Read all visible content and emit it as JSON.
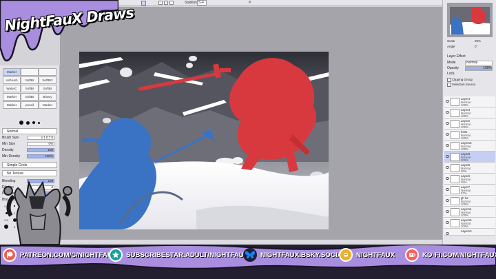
{
  "overlay": {
    "logo_text": "NightFauX Draws",
    "footer_links": [
      {
        "icon": "patreon-icon",
        "text": "PATREON.COM/C/NIGHTFAUX",
        "color": "#f15d4e"
      },
      {
        "icon": "subscribestar-icon",
        "text": "SUBSCRIBESTAR.ADULT/NIGHTFAUX",
        "color": "#1aa0a0"
      },
      {
        "icon": "bluesky-icon",
        "text": "NIGHTFAUX.BSKY.SOCIAL",
        "color": "#1185fe"
      },
      {
        "icon": "sun-mascot-icon",
        "text": "NIGHTFAUX",
        "color": "#f0b020"
      },
      {
        "icon": "kofi-icon",
        "text": "KO-FI.COM/NIGHTFAUX",
        "color": "#ff5e5b"
      }
    ]
  },
  "toolbar": {
    "stabilizer_label": "Stabilizer",
    "stabilizer_value": "S-4"
  },
  "tools": {
    "rows": [
      [
        "Marker",
        "",
        ""
      ],
      [
        "Airbrush",
        "SoftBr",
        "SoftBr2"
      ],
      [
        "WaterC",
        "SoftBr",
        "SoftBr"
      ],
      [
        "Marker",
        "SoftBr",
        "Binary"
      ],
      [
        "Marker",
        "pencil",
        "Marker"
      ]
    ]
  },
  "brush": {
    "mode": "Normal",
    "size_label": "Brush Size",
    "size_multiplier": "x 1.0",
    "size_value": "7.0",
    "min_size_label": "Min Size",
    "min_size_value": "0%",
    "density_label": "Density",
    "density_value": "100",
    "min_density_label": "Min Density",
    "min_density_value": "100%",
    "shape": "Simple Circle",
    "texture": "No Texture",
    "blending_label": "Blending",
    "blending_value": "100",
    "dilution_label": "Dilution",
    "dilution_value": "0",
    "persistence_label": "Persistence",
    "persistence_value": "80",
    "blur_label": "Blur Pressure",
    "size_presets": [
      "0.7",
      "0.8",
      "1",
      "1.5",
      "2",
      "2.3",
      "2.6",
      "3",
      "3.5",
      "4",
      "5",
      "6"
    ]
  },
  "navigator": {
    "scale_label": "Scale",
    "scale_value": "25%",
    "angle_label": "Angle",
    "angle_value": "0°"
  },
  "layer_panel": {
    "layer_effect": "Layer Effect",
    "mode_label": "Mode",
    "mode_value": "Normal",
    "opacity_label": "Opacity",
    "opacity_value": "100%",
    "lock_label": "Lock",
    "clipping_group": "Clipping Group",
    "selection_source": "Selection Source",
    "layers": [
      {
        "name": "Layer4",
        "mode": "Normal",
        "opacity": "100%",
        "selected": false
      },
      {
        "name": "Layer3",
        "mode": "Normal",
        "opacity": "100%",
        "selected": false
      },
      {
        "name": "Layer2",
        "mode": "Normal",
        "opacity": "100%",
        "selected": false
      },
      {
        "name": "fonts",
        "mode": "Normal",
        "opacity": "100%",
        "selected": false
      },
      {
        "name": "Layer16",
        "mode": "Normal",
        "opacity": "100%",
        "selected": false
      },
      {
        "name": "Layer9",
        "mode": "Normal",
        "opacity": "100%",
        "selected": true
      },
      {
        "name": "Layer5",
        "mode": "Normal",
        "opacity": "26%",
        "selected": false
      },
      {
        "name": "Layer6",
        "mode": "Normal",
        "opacity": "26%",
        "selected": false
      },
      {
        "name": "Layer7",
        "mode": "Normal",
        "opacity": "57%",
        "selected": false
      },
      {
        "name": "gh fur",
        "mode": "Normal",
        "opacity": "100%",
        "selected": false
      },
      {
        "name": "Layer14",
        "mode": "Normal",
        "opacity": "100%",
        "selected": false
      },
      {
        "name": "Layer15",
        "mode": "Normal",
        "opacity": "100%",
        "selected": false
      },
      {
        "name": "Layer13",
        "mode": "Normal",
        "opacity": "100%",
        "selected": false
      }
    ]
  },
  "colors": {
    "red_figure": "#d8393e",
    "blue_figure": "#3a73c4",
    "sky_dark": "#4a4a55",
    "footer_bg": "#231f30",
    "drip_purple": "#a98ee0"
  }
}
